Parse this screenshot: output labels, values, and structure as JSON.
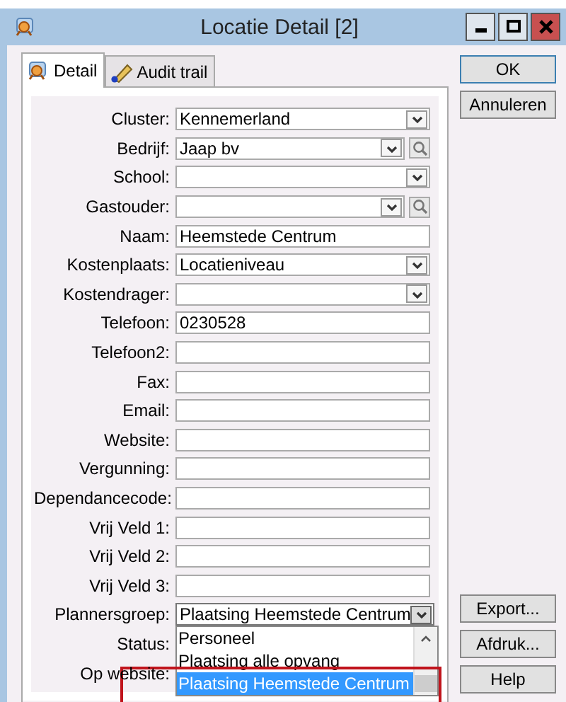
{
  "window": {
    "title": "Locatie Detail [2]"
  },
  "tabs": [
    {
      "label": "Detail",
      "kind": "detail",
      "selected": true
    },
    {
      "label": "Audit trail",
      "kind": "audit",
      "selected": false
    }
  ],
  "fields": [
    {
      "label": "Cluster:",
      "kind": "combo",
      "value": "Kennemerland",
      "open": false
    },
    {
      "label": "Bedrijf:",
      "kind": "combo_search",
      "value": "Jaap bv",
      "open": false
    },
    {
      "label": "School:",
      "kind": "combo",
      "open": false
    },
    {
      "label": "Gastouder:",
      "kind": "combo_search",
      "open": false
    },
    {
      "label": "Naam:",
      "kind": "text",
      "value": "Heemstede Centrum"
    },
    {
      "label": "Kostenplaats:",
      "kind": "combo",
      "value": "Locatieniveau",
      "open": false
    },
    {
      "label": "Kostendrager:",
      "kind": "combo",
      "open": false
    },
    {
      "label": "Telefoon:",
      "kind": "text",
      "value": "0230528"
    },
    {
      "label": "Telefoon2:",
      "kind": "text"
    },
    {
      "label": "Fax:",
      "kind": "text"
    },
    {
      "label": "Email:",
      "kind": "text"
    },
    {
      "label": "Website:",
      "kind": "text"
    },
    {
      "label": "Vergunning:",
      "kind": "text"
    },
    {
      "label": "Dependancecode:",
      "kind": "text"
    },
    {
      "label": "Vrij Veld 1:",
      "kind": "text"
    },
    {
      "label": "Vrij Veld 2:",
      "kind": "text"
    },
    {
      "label": "Vrij Veld 3:",
      "kind": "text"
    },
    {
      "label": "Plannersgroep:",
      "kind": "combo",
      "value": "Plaatsing Heemstede Centrum",
      "open": true
    },
    {
      "label": "Status:",
      "kind": "covered"
    },
    {
      "label": "Op website:",
      "kind": "covered"
    }
  ],
  "dropdown": {
    "items": [
      {
        "label": "Personeel",
        "selected": false
      },
      {
        "label": "Plaatsing alle opvang",
        "selected": false
      },
      {
        "label": "Plaatsing Heemstede Centrum",
        "selected": true
      }
    ]
  },
  "annotation": {
    "kind": "rectangle"
  },
  "buttons_top": [
    {
      "label": "OK",
      "default": true
    },
    {
      "label": "Annuleren",
      "default": false
    }
  ],
  "buttons_bottom": [
    {
      "label": "Export...",
      "default": false
    },
    {
      "label": "Afdruk...",
      "default": false
    },
    {
      "label": "Help",
      "default": false
    }
  ]
}
